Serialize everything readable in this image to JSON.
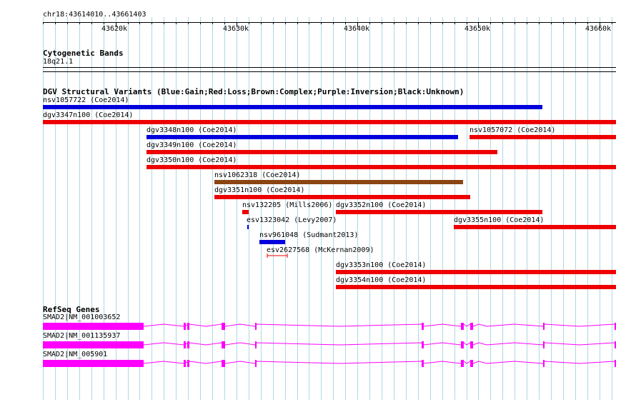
{
  "ruler": {
    "location": "chr18:43614010..43661403",
    "ticks": [
      "43620k",
      "43630k",
      "43640k",
      "43650k",
      "43660k"
    ]
  },
  "cytobands": {
    "title": "Cytogenetic Bands",
    "band_label": "18q21.1"
  },
  "dgv": {
    "title": "DGV Structural Variants (Blue:Gain;Red:Loss;Brown:Complex;Purple:Inversion;Black:Unknown)",
    "variants": [
      {
        "label": "nsv1057722 (Coe2014)",
        "type": "gain"
      },
      {
        "label": "dgv3347n100 (Coe2014)",
        "type": "loss"
      },
      {
        "label": "dgv3348n100 (Coe2014)",
        "type": "gain"
      },
      {
        "label": "nsv1057072 (Coe2014)",
        "type": "loss"
      },
      {
        "label": "dgv3349n100 (Coe2014)",
        "type": "loss"
      },
      {
        "label": "dgv3350n100 (Coe2014)",
        "type": "loss"
      },
      {
        "label": "nsv1062318 (Coe2014)",
        "type": "complex"
      },
      {
        "label": "dgv3351n100 (Coe2014)",
        "type": "loss"
      },
      {
        "label": "nsv132205 (Mills2006)",
        "type": "loss"
      },
      {
        "label": "dgv3352n100 (Coe2014)",
        "type": "loss"
      },
      {
        "label": "esv1323042 (Levy2007)",
        "type": "gain"
      },
      {
        "label": "dgv3355n100 (Coe2014)",
        "type": "loss"
      },
      {
        "label": "nsv961048 (Sudmant2013)",
        "type": "gain"
      },
      {
        "label": "esv2627568 (McKernan2009)",
        "type": "loss"
      },
      {
        "label": "dgv3353n100 (Coe2014)",
        "type": "loss"
      },
      {
        "label": "dgv3354n100 (Coe2014)",
        "type": "loss"
      }
    ]
  },
  "refseq": {
    "title": "RefSeq Genes",
    "genes": [
      {
        "label": "SMAD2|NM_001003652"
      },
      {
        "label": "SMAD2|NM_001135937"
      },
      {
        "label": "SMAD2|NM_005901"
      }
    ]
  },
  "colors": {
    "gain": "#0000dd",
    "loss": "#ee0000",
    "complex": "#8b4513",
    "gene": "#ff00ff",
    "grid": "#add8e6"
  }
}
